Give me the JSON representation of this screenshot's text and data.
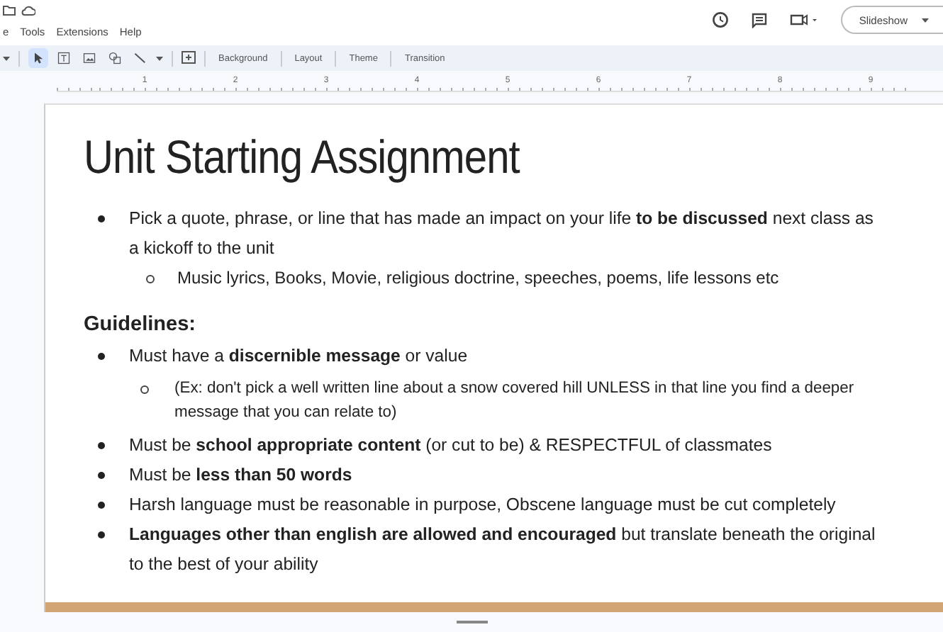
{
  "menu": [
    "e",
    "Tools",
    "Extensions",
    "Help"
  ],
  "toolbar": {
    "tools": [
      {
        "kind": "select",
        "selected": true
      },
      {
        "kind": "textbox",
        "selected": false
      },
      {
        "kind": "image",
        "selected": false
      },
      {
        "kind": "shape",
        "selected": false
      },
      {
        "kind": "line",
        "selected": false
      }
    ],
    "buttons": [
      "Background",
      "Layout",
      "Theme",
      "Transition"
    ]
  },
  "slideshow_button": "Slideshow",
  "ruler": [
    "1",
    "2",
    "3",
    "4",
    "5",
    "6",
    "7",
    "8",
    "9"
  ],
  "slide": {
    "title": "Unit Starting Assignment",
    "sections": [
      {
        "bullets": [
          {
            "text": "Pick a quote, phrase, or line that has made an impact on your life **to be discussed** next class as a kickoff to the unit",
            "children": [
              {
                "text": "Music lyrics, Books, Movie, religious doctrine, speeches, poems, life lessons etc"
              }
            ]
          }
        ]
      },
      {
        "heading": "Guidelines:",
        "bullets": [
          {
            "text": "Must have a **discernible message** or value",
            "children": [
              {
                "text": "(Ex: don't pick a well written line about a snow covered hill UNLESS in that line you find a deeper message that you can relate to)"
              }
            ]
          },
          {
            "text": "Must be **school appropriate content** (or cut to be) & RESPECTFUL of classmates"
          },
          {
            "text": "Must be **less than 50 words**"
          },
          {
            "text": "Harsh language must be reasonable in purpose, Obscene language must be cut completely"
          },
          {
            "text": "**Languages other than english are allowed and encouraged** but translate beneath the original to the best of your ability"
          }
        ]
      }
    ]
  }
}
